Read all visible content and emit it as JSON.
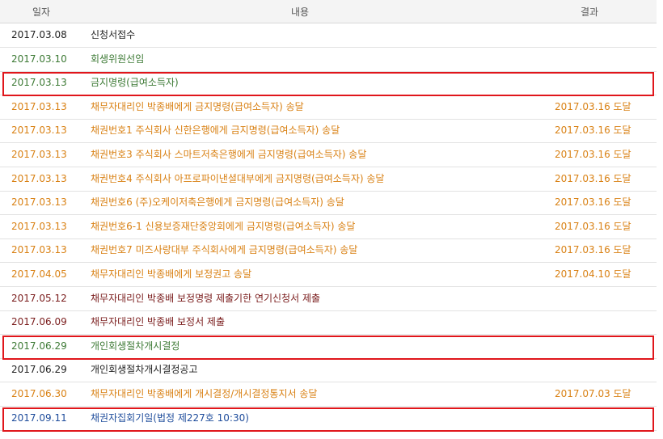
{
  "header": {
    "date": "일자",
    "content": "내용",
    "result": "결과"
  },
  "colors": {
    "black": "#222222",
    "green": "#3d7a35",
    "orange": "#d98114",
    "maroon": "#7a1c1c",
    "blue": "#1f4d9c",
    "highlight": "#e0161b"
  },
  "rows": [
    {
      "date": "2017.03.08",
      "content": "신청서접수",
      "result": "",
      "color": "black",
      "highlighted": false
    },
    {
      "date": "2017.03.10",
      "content": "회생위원선임",
      "result": "",
      "color": "green",
      "highlighted": false
    },
    {
      "date": "2017.03.13",
      "content": "금지명령(급여소득자)",
      "result": "",
      "color": "green",
      "highlighted": true
    },
    {
      "date": "2017.03.13",
      "content": "채무자대리인 박종배에게 금지명령(급여소득자) 송달",
      "result": "2017.03.16 도달",
      "color": "orange",
      "highlighted": false
    },
    {
      "date": "2017.03.13",
      "content": "채권번호1 주식회사 신한은행에게 금지명령(급여소득자) 송달",
      "result": "2017.03.16 도달",
      "color": "orange",
      "highlighted": false
    },
    {
      "date": "2017.03.13",
      "content": "채권번호3 주식회사 스마트저축은행에게 금지명령(급여소득자) 송달",
      "result": "2017.03.16 도달",
      "color": "orange",
      "highlighted": false
    },
    {
      "date": "2017.03.13",
      "content": "채권번호4 주식회사 아프로파이낸셜대부에게 금지명령(급여소득자) 송달",
      "result": "2017.03.16 도달",
      "color": "orange",
      "highlighted": false
    },
    {
      "date": "2017.03.13",
      "content": "채권번호6 (주)오케이저축은행에게 금지명령(급여소득자) 송달",
      "result": "2017.03.16 도달",
      "color": "orange",
      "highlighted": false
    },
    {
      "date": "2017.03.13",
      "content": "채권번호6-1 신용보증재단중앙회에게 금지명령(급여소득자) 송달",
      "result": "2017.03.16 도달",
      "color": "orange",
      "highlighted": false
    },
    {
      "date": "2017.03.13",
      "content": "채권번호7 미즈사랑대부 주식회사에게 금지명령(급여소득자) 송달",
      "result": "2017.03.16 도달",
      "color": "orange",
      "highlighted": false
    },
    {
      "date": "2017.04.05",
      "content": "채무자대리인 박종배에게 보정권고 송달",
      "result": "2017.04.10 도달",
      "color": "orange",
      "highlighted": false
    },
    {
      "date": "2017.05.12",
      "content": "채무자대리인 박종배 보정명령 제출기한 연기신청서 제출",
      "result": "",
      "color": "maroon",
      "highlighted": false
    },
    {
      "date": "2017.06.09",
      "content": "채무자대리인 박종배 보정서 제출",
      "result": "",
      "color": "maroon",
      "highlighted": false
    },
    {
      "date": "2017.06.29",
      "content": "개인회생절차개시결정",
      "result": "",
      "color": "green",
      "highlighted": true
    },
    {
      "date": "2017.06.29",
      "content": "개인회생절차개시결정공고",
      "result": "",
      "color": "black",
      "highlighted": false
    },
    {
      "date": "2017.06.30",
      "content": "채무자대리인 박종배에게 개시결정/개시결정통지서 송달",
      "result": "2017.07.03 도달",
      "color": "orange",
      "highlighted": false
    },
    {
      "date": "2017.09.11",
      "content": "채권자집회기일(법정 제227호 10:30)",
      "result": "",
      "color": "blue",
      "highlighted": true
    }
  ]
}
